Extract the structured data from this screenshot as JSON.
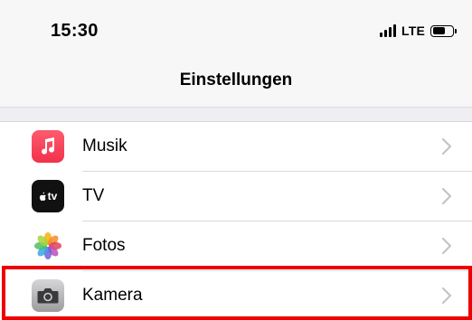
{
  "status_bar": {
    "time": "15:30",
    "network": "LTE",
    "battery_level": 0.62
  },
  "nav": {
    "title": "Einstellungen"
  },
  "settings_rows": [
    {
      "label": "Musik",
      "icon": "music-note-icon"
    },
    {
      "label": "TV",
      "icon": "apple-tv-icon",
      "icon_text": "tv"
    },
    {
      "label": "Fotos",
      "icon": "photos-flower-icon"
    },
    {
      "label": "Kamera",
      "icon": "camera-icon"
    }
  ],
  "highlight": {
    "target": "Kamera",
    "color": "#ee0000"
  },
  "colors": {
    "header_bg": "#f7f7f7",
    "music_icon": "#f2314b",
    "tv_icon": "#111111",
    "chevron": "#c4c4c7"
  }
}
